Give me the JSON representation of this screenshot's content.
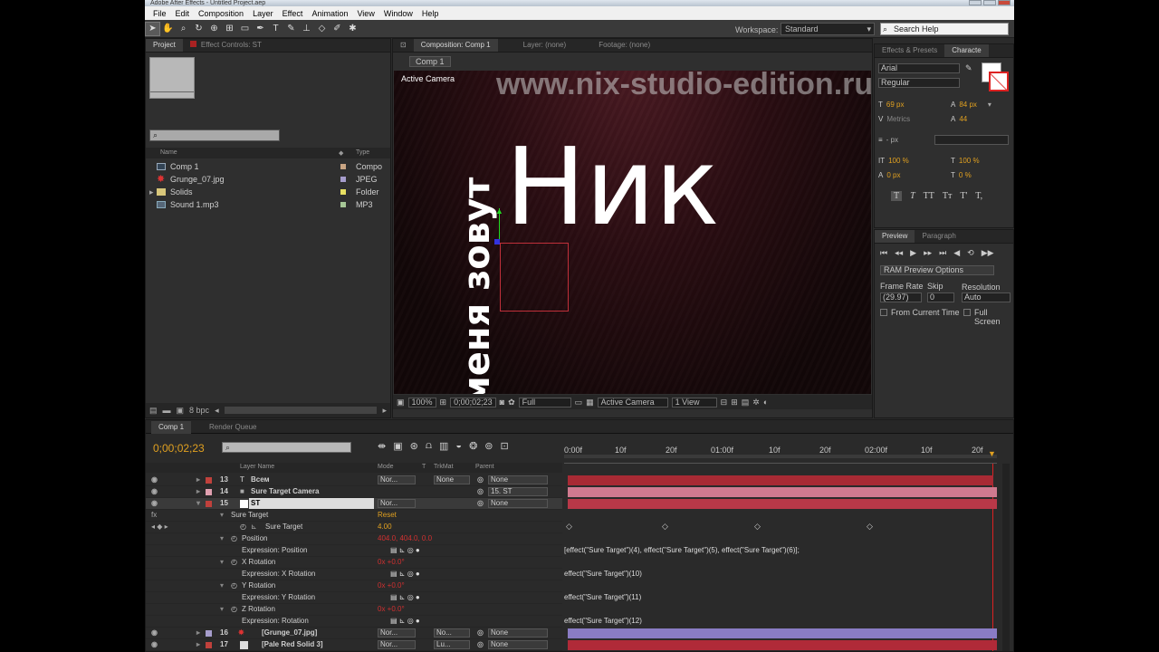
{
  "window": {
    "title": "Adobe After Effects - Untitled Project.aep"
  },
  "menu": [
    "File",
    "Edit",
    "Composition",
    "Layer",
    "Effect",
    "Animation",
    "View",
    "Window",
    "Help"
  ],
  "toolbar": {
    "workspace_label": "Workspace:",
    "workspace_value": "Standard",
    "search_placeholder": "Search Help"
  },
  "project": {
    "tabs": [
      "Project",
      "Effect Controls: ST"
    ],
    "search_placeholder": "⌕",
    "columns": {
      "name": "Name",
      "type": "Type"
    },
    "items": [
      {
        "name": "Comp 1",
        "type": "Compo",
        "label_color": "#c9a583",
        "icon": "composition-icon"
      },
      {
        "name": "Grunge_07.jpg",
        "type": "JPEG",
        "label_color": "#a69dcc",
        "icon": "image-icon"
      },
      {
        "name": "Solids",
        "type": "Folder",
        "label_color": "#e8e062",
        "icon": "folder-icon"
      },
      {
        "name": "Sound 1.mp3",
        "type": "MP3",
        "label_color": "#a6c796",
        "icon": "audio-icon"
      }
    ],
    "bpc": "8 bpc"
  },
  "composition": {
    "tabs": [
      "Composition: Comp 1",
      "Layer: (none)",
      "Footage: (none)"
    ],
    "sub_tab": "Comp 1",
    "view_label": "Active Camera",
    "watermark": "www.nix-studio-edition.ru",
    "main_text": "Ник",
    "vertical_text": "меня зовут",
    "footer": {
      "zoom": "100%",
      "timecode": "0;00;02;23",
      "resolution": "Full",
      "camera": "Active Camera",
      "views": "1 View"
    }
  },
  "character": {
    "tabs": [
      "Effects & Presets",
      "Characte"
    ],
    "font": "Arial",
    "style": "Regular",
    "size": "69 px",
    "leading": "84 px",
    "kerning": "Metrics",
    "tracking": "44",
    "stroke": "- px",
    "vscale": "100 %",
    "hscale": "100 %",
    "baseline": "0 px",
    "tsume": "0 %",
    "styles": [
      "T",
      "T",
      "TT",
      "Tт",
      "T'",
      "T,"
    ]
  },
  "preview": {
    "tabs": [
      "Preview",
      "Paragraph"
    ],
    "ram_options": "RAM Preview Options",
    "frame_rate_label": "Frame Rate",
    "skip_label": "Skip",
    "resolution_label": "Resolution",
    "frame_rate": "(29.97)",
    "skip": "0",
    "resolution": "Auto",
    "from_current": "From Current Time",
    "full_screen": "Full Screen"
  },
  "timeline": {
    "tabs": [
      "Comp 1",
      "Render Queue"
    ],
    "timecode": "0;00;02;23",
    "columns": {
      "layer": "Layer Name",
      "mode": "Mode",
      "t": "T",
      "trkmat": "TrkMat",
      "parent": "Parent"
    },
    "ruler": [
      "0:00f",
      "10f",
      "20f",
      "01:00f",
      "10f",
      "20f",
      "02:00f",
      "10f",
      "20f"
    ],
    "layers": [
      {
        "num": "13",
        "name": "Всем",
        "mode": "Nor...",
        "trk": "None",
        "parent": "None",
        "label": "#c0413c",
        "bar": "#a82a34"
      },
      {
        "num": "14",
        "name": "Sure Target Camera",
        "mode": "",
        "trk": "",
        "parent": "15. ST",
        "label": "#e0a0b0",
        "bar": "#d07a90"
      },
      {
        "num": "15",
        "name": "ST",
        "mode": "Nor...",
        "trk": "",
        "parent": "None",
        "label": "#c0413c",
        "bar": "#b83848"
      }
    ],
    "props": [
      {
        "name": "Sure Target",
        "value": "Reset",
        "indent": 1
      },
      {
        "name": "Sure Target",
        "value": "4.00",
        "indent": 3
      },
      {
        "name": "Position",
        "value": "404.0, 404.0, 0.0",
        "indent": 2
      },
      {
        "name": "Expression: Position",
        "value": "",
        "indent": 3,
        "expr": "[effect(\"Sure Target\")(4), effect(\"Sure Target\")(5), effect(\"Sure Target\")(6)];"
      },
      {
        "name": "X Rotation",
        "value": "0x +0.0°",
        "indent": 2
      },
      {
        "name": "Expression: X Rotation",
        "value": "",
        "indent": 3,
        "expr": "effect(\"Sure Target\")(10)"
      },
      {
        "name": "Y Rotation",
        "value": "0x +0.0°",
        "indent": 2
      },
      {
        "name": "Expression: Y Rotation",
        "value": "",
        "indent": 3,
        "expr": "effect(\"Sure Target\")(11)"
      },
      {
        "name": "Z Rotation",
        "value": "0x +0.0°",
        "indent": 2
      },
      {
        "name": "Expression: Rotation",
        "value": "",
        "indent": 3,
        "expr": "effect(\"Sure Target\")(12)"
      }
    ],
    "bottom_layers": [
      {
        "num": "16",
        "name": "[Grunge_07.jpg]",
        "mode": "Nor...",
        "trk": "No...",
        "parent": "None",
        "label": "#a69dcc",
        "bar": "#8a7cc4"
      },
      {
        "num": "17",
        "name": "[Pale Red Solid 3]",
        "mode": "Nor...",
        "trk": "Lu...",
        "parent": "None",
        "label": "#c0413c",
        "bar": "#b02a38"
      }
    ]
  }
}
